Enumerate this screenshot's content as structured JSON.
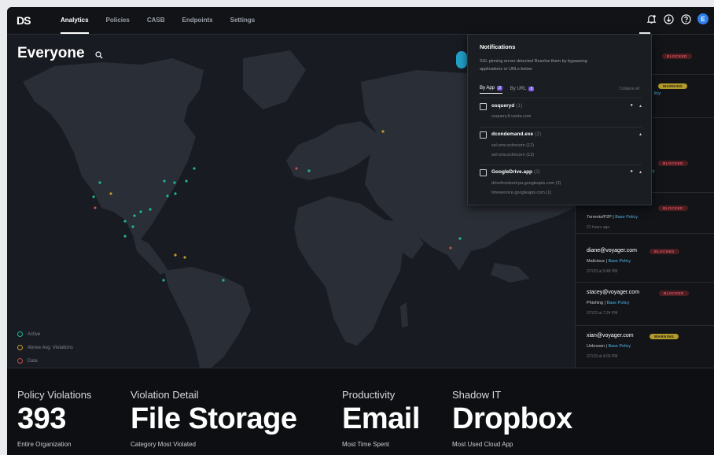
{
  "app": {
    "logo": "DS"
  },
  "nav": {
    "items": [
      "Analytics",
      "Policies",
      "CASB",
      "Endpoints",
      "Settings"
    ],
    "active": "Analytics"
  },
  "nav_icons": [
    "notification-bell-icon",
    "download-icon",
    "help-icon"
  ],
  "user": {
    "avatar_letter": "E"
  },
  "map": {
    "title": "Everyone",
    "legend": [
      "Active",
      "Above Avg. Violations",
      "Data"
    ],
    "colors": {
      "active": "#1fb59a",
      "above_avg": "#c89a2a",
      "data": "#c0504d"
    }
  },
  "notifications": {
    "title": "Notifications",
    "description": "SSL pinning errors detected Resolve them by bypassing applications or URLs below",
    "tabs": [
      {
        "label": "By App",
        "count": "3"
      },
      {
        "label": "By URL",
        "count": "8"
      }
    ],
    "collapse_label": "Collapse all",
    "apps": [
      {
        "name": "osqueryd",
        "count": "(1)",
        "hosts": [
          "osquery.tl.vanta.com"
        ]
      },
      {
        "name": "dcondemand.exe",
        "count": "(2)",
        "hosts": [
          "ssl-cms.echocorn (12)",
          "ssl-cms.echocorn (12)"
        ]
      },
      {
        "name": "GoogleDrive.app",
        "count": "(2)",
        "hosts": [
          "drivefrontend-pa.googleapis.com (3)",
          "timeservice.googleapis.com (1)"
        ]
      }
    ]
  },
  "feed": {
    "partial": [
      {
        "badge": "BLOCKED"
      },
      {
        "badge": "WARNING",
        "policy": "licy"
      },
      {
        "badge": "BLOCKED",
        "policy": "cy"
      }
    ],
    "items": [
      {
        "user": "",
        "badge": "BLOCKED",
        "category": "Torrents/P2P",
        "policy": "Base Policy",
        "time": "21 hours ago"
      },
      {
        "user": "diane@voyager.com",
        "badge": "BLOCKED",
        "category": "Malicious",
        "policy": "Base Policy",
        "time": "2/7/23 at 9:48 PM"
      },
      {
        "user": "stacey@voyager.com",
        "badge": "BLOCKED",
        "category": "Phishing",
        "policy": "Base Policy",
        "time": "2/7/23 at 7:24 PM"
      },
      {
        "user": "xian@voyager.com",
        "badge": "WARNING",
        "category": "Unknown",
        "policy": "Base Policy",
        "time": "2/7/23 at 4:03 PM"
      }
    ]
  },
  "stats": [
    {
      "label": "Policy Violations",
      "value": "393",
      "sub": "Entire Organization"
    },
    {
      "label": "Violation Detail",
      "value": "File Storage",
      "sub": "Category Most Violated"
    },
    {
      "label": "Productivity",
      "value": "Email",
      "sub": "Most Time Spent"
    },
    {
      "label": "Shadow IT",
      "value": "Dropbox",
      "sub": "Most Used Cloud App"
    }
  ]
}
